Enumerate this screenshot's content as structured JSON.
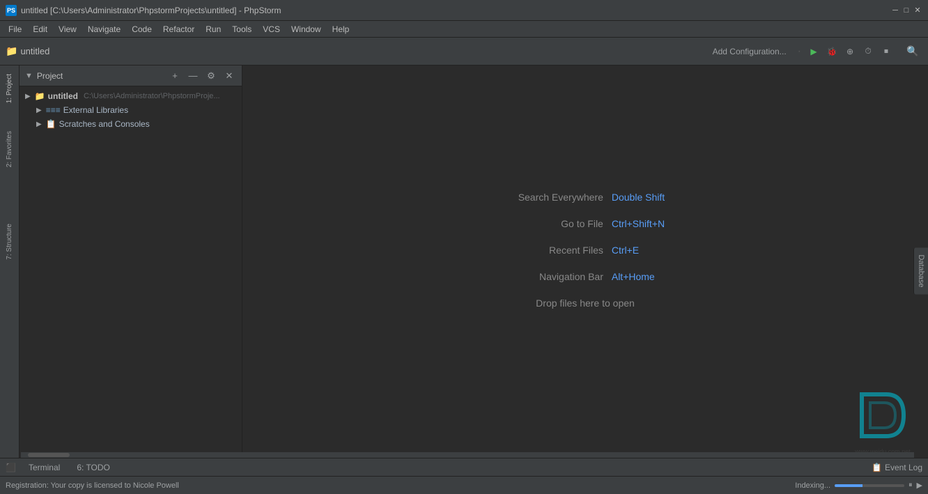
{
  "window": {
    "title": "untitled [C:\\Users\\Administrator\\PhpstormProjects\\untitled] - PhpStorm",
    "app_name": "PhpStorm",
    "icon_label": "PS"
  },
  "title_bar": {
    "minimize_label": "─",
    "maximize_label": "□",
    "close_label": "✕"
  },
  "menu": {
    "items": [
      "File",
      "Edit",
      "View",
      "Navigate",
      "Code",
      "Refactor",
      "Run",
      "Tools",
      "VCS",
      "Window",
      "Help"
    ]
  },
  "toolbar": {
    "project_name": "untitled",
    "add_config_label": "Add Configuration...",
    "run_icon": "▶",
    "debug_icon": "⬛",
    "coverage_icon": "⬛",
    "profile_icon": "⬛",
    "stop_icon": "⬛",
    "search_icon": "🔍"
  },
  "project_panel": {
    "title": "Project",
    "actions": {
      "add": "+",
      "collapse": "—",
      "settings": "⚙",
      "close": "✕"
    },
    "tree": [
      {
        "level": 1,
        "label": "untitled",
        "path": "C:\\Users\\Administrator\\PhpstormProje...",
        "type": "folder",
        "expanded": true,
        "arrow": "▶"
      },
      {
        "level": 2,
        "label": "External Libraries",
        "type": "library",
        "expanded": false,
        "arrow": "▶"
      },
      {
        "level": 2,
        "label": "Scratches and Consoles",
        "type": "scratch",
        "expanded": false,
        "arrow": "▶"
      }
    ]
  },
  "side_tabs": {
    "left": [
      "1: Project",
      "2: Favorites",
      "7: Structure"
    ],
    "right": [
      "Database"
    ]
  },
  "editor": {
    "welcome": {
      "search_label": "Search Everywhere",
      "search_shortcut": "Double Shift",
      "goto_label": "Go to File",
      "goto_shortcut": "Ctrl+Shift+N",
      "recent_label": "Recent Files",
      "recent_shortcut": "Ctrl+E",
      "nav_label": "Navigation Bar",
      "nav_shortcut": "Alt+Home",
      "drop_label": "Drop files here to open"
    }
  },
  "bottom_tabs": [
    {
      "id": "terminal",
      "label": "Terminal",
      "icon": "⬛"
    },
    {
      "id": "todo",
      "label": "6: TODO",
      "icon": "☰"
    }
  ],
  "status_bar": {
    "registration": "Registration: Your copy is licensed to Nicole Powell",
    "indexing": "Indexing...",
    "event_log": "Event Log",
    "pause_icon": "⏸",
    "play_icon": "▶"
  },
  "colors": {
    "accent_blue": "#589df6",
    "bg_dark": "#2b2b2b",
    "bg_panel": "#3c3f41",
    "text_normal": "#a9b7c6",
    "text_muted": "#888888",
    "folder_blue": "#6897bb"
  }
}
